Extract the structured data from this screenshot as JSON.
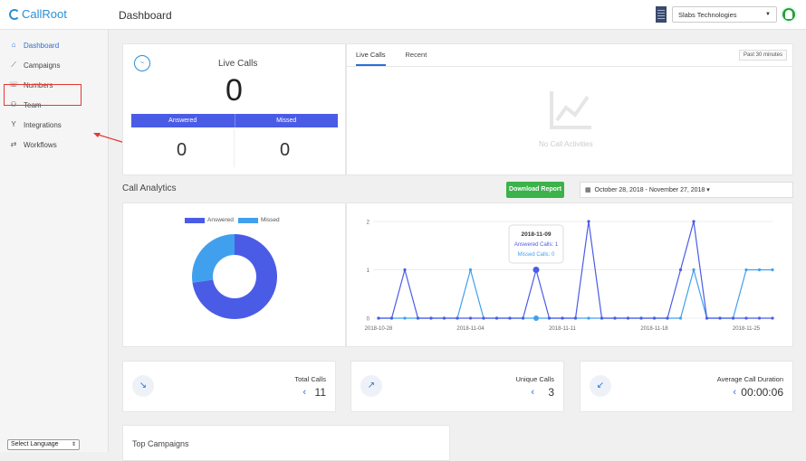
{
  "app": {
    "logo_text": "CallRoot",
    "page_title": "Dashboard"
  },
  "header": {
    "org_name": "Slabs Technologies"
  },
  "sidebar": {
    "items": [
      {
        "label": "Dashboard",
        "icon": "home-icon",
        "active": true
      },
      {
        "label": "Campaigns",
        "icon": "line-chart-icon"
      },
      {
        "label": "Numbers",
        "icon": "phone-icon"
      },
      {
        "label": "Team",
        "icon": "team-icon"
      },
      {
        "label": "Integrations",
        "icon": "fork-icon",
        "highlighted": true
      },
      {
        "label": "Workflows",
        "icon": "repeat-icon"
      }
    ],
    "language_select": "Select Language"
  },
  "live": {
    "title": "Live Calls",
    "count": "0",
    "answered_label": "Answered",
    "missed_label": "Missed",
    "answered": "0",
    "missed": "0"
  },
  "livecalls": {
    "tabs": [
      "Live Calls",
      "Recent"
    ],
    "period": "Past 30 minutes",
    "empty_text": "No Call Activities"
  },
  "analytics": {
    "title": "Call Analytics",
    "download_label": "Download Report",
    "date_range": "October 28, 2018 - November 27, 2018"
  },
  "colors": {
    "answered": "#4a5ce6",
    "missed": "#41a0ee",
    "accent": "#2a6fd6",
    "download": "#3bb24a"
  },
  "chart_data": [
    {
      "type": "pie",
      "legend": [
        "Answered",
        "Missed"
      ],
      "values": [
        8,
        3
      ],
      "colors": [
        "#4a5ce6",
        "#41a0ee"
      ]
    },
    {
      "type": "line",
      "x_ticks": [
        "2018-10-28",
        "2018-11-04",
        "2018-11-11",
        "2018-11-18",
        "2018-11-25"
      ],
      "ylim": [
        0,
        2
      ],
      "y_ticks": [
        "0",
        "1",
        "2"
      ],
      "x_start": "2018-10-28",
      "x_end": "2018-11-27",
      "series": [
        {
          "name": "Answered Calls",
          "color": "#4a5ce6",
          "x": [
            "2018-10-28",
            "2018-10-29",
            "2018-10-30",
            "2018-10-31",
            "2018-11-01",
            "2018-11-02",
            "2018-11-03",
            "2018-11-04",
            "2018-11-05",
            "2018-11-06",
            "2018-11-07",
            "2018-11-08",
            "2018-11-09",
            "2018-11-10",
            "2018-11-11",
            "2018-11-12",
            "2018-11-13",
            "2018-11-14",
            "2018-11-15",
            "2018-11-16",
            "2018-11-17",
            "2018-11-18",
            "2018-11-19",
            "2018-11-20",
            "2018-11-21",
            "2018-11-22",
            "2018-11-23",
            "2018-11-24",
            "2018-11-25",
            "2018-11-26",
            "2018-11-27"
          ],
          "values": [
            0,
            0,
            1,
            0,
            0,
            0,
            0,
            0,
            0,
            0,
            0,
            0,
            1,
            0,
            0,
            0,
            2,
            0,
            0,
            0,
            0,
            0,
            0,
            1,
            2,
            0,
            0,
            0,
            0,
            0,
            0
          ]
        },
        {
          "name": "Missed Calls",
          "color": "#41a0ee",
          "x": [
            "2018-10-28",
            "2018-10-29",
            "2018-10-30",
            "2018-10-31",
            "2018-11-01",
            "2018-11-02",
            "2018-11-03",
            "2018-11-04",
            "2018-11-05",
            "2018-11-06",
            "2018-11-07",
            "2018-11-08",
            "2018-11-09",
            "2018-11-10",
            "2018-11-11",
            "2018-11-12",
            "2018-11-13",
            "2018-11-14",
            "2018-11-15",
            "2018-11-16",
            "2018-11-17",
            "2018-11-18",
            "2018-11-19",
            "2018-11-20",
            "2018-11-21",
            "2018-11-22",
            "2018-11-23",
            "2018-11-24",
            "2018-11-25",
            "2018-11-26",
            "2018-11-27"
          ],
          "values": [
            0,
            0,
            0,
            0,
            0,
            0,
            0,
            1,
            0,
            0,
            0,
            0,
            0,
            0,
            0,
            0,
            0,
            0,
            0,
            0,
            0,
            0,
            0,
            0,
            1,
            0,
            0,
            0,
            1,
            1,
            1
          ]
        }
      ],
      "tooltip": {
        "date": "2018-11-09",
        "answered": "Answered Calls: 1",
        "missed": "Missed Calls: 0"
      }
    }
  ],
  "stats": [
    {
      "title": "Total Calls",
      "value": "11",
      "icon": "phone-in-icon"
    },
    {
      "title": "Unique Calls",
      "value": "3",
      "icon": "phone-forward-icon"
    },
    {
      "title": "Average Call Duration",
      "value": "00:00:06",
      "icon": "phone-callback-icon"
    }
  ],
  "top_campaigns": {
    "title": "Top Campaigns"
  }
}
